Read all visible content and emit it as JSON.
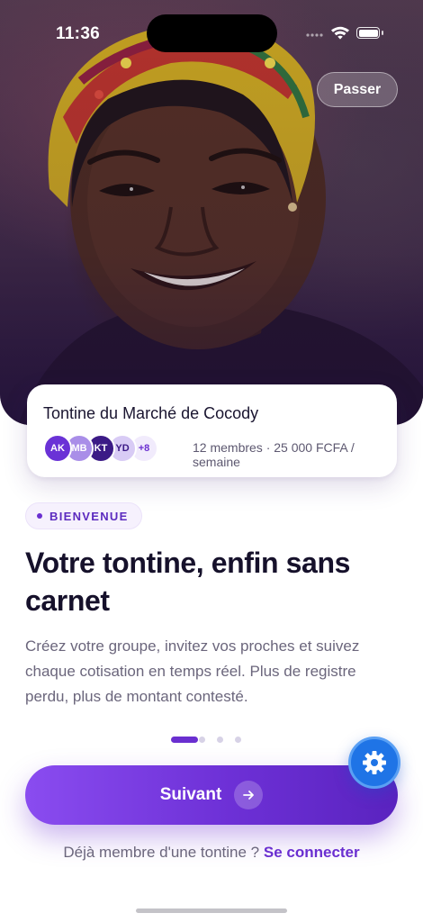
{
  "status_bar": {
    "time": "11:36"
  },
  "hero": {
    "skip_label": "Passer"
  },
  "group_card": {
    "name": "Tontine du Marché de Cocody",
    "avatars": [
      {
        "initials": "AK",
        "bg": "#6a32d6",
        "fg": "#ffffff"
      },
      {
        "initials": "MB",
        "bg": "#a98ee8",
        "fg": "#ffffff"
      },
      {
        "initials": "KT",
        "bg": "#3b1a86",
        "fg": "#ffffff"
      },
      {
        "initials": "YD",
        "bg": "#d8cbf5",
        "fg": "#3b1a86"
      }
    ],
    "more_count": "+8",
    "meta": "12 membres · 25 000 FCFA / semaine"
  },
  "badge": {
    "label": "BIENVENUE"
  },
  "headline": "Votre tontine, enfin sans carnet",
  "description": "Créez votre groupe, invitez vos proches et suivez chaque cotisation en temps réel. Plus de registre perdu, plus de montant contesté.",
  "pagination": {
    "total": 3,
    "current": 1
  },
  "cta": {
    "label": "Suivant",
    "icon": "arrow-right-icon"
  },
  "login": {
    "prompt": "Déjà membre d'une tontine ?",
    "link": "Se connecter"
  },
  "colors": {
    "primary": "#6d30d6",
    "accent_blue": "#1f74e6"
  }
}
